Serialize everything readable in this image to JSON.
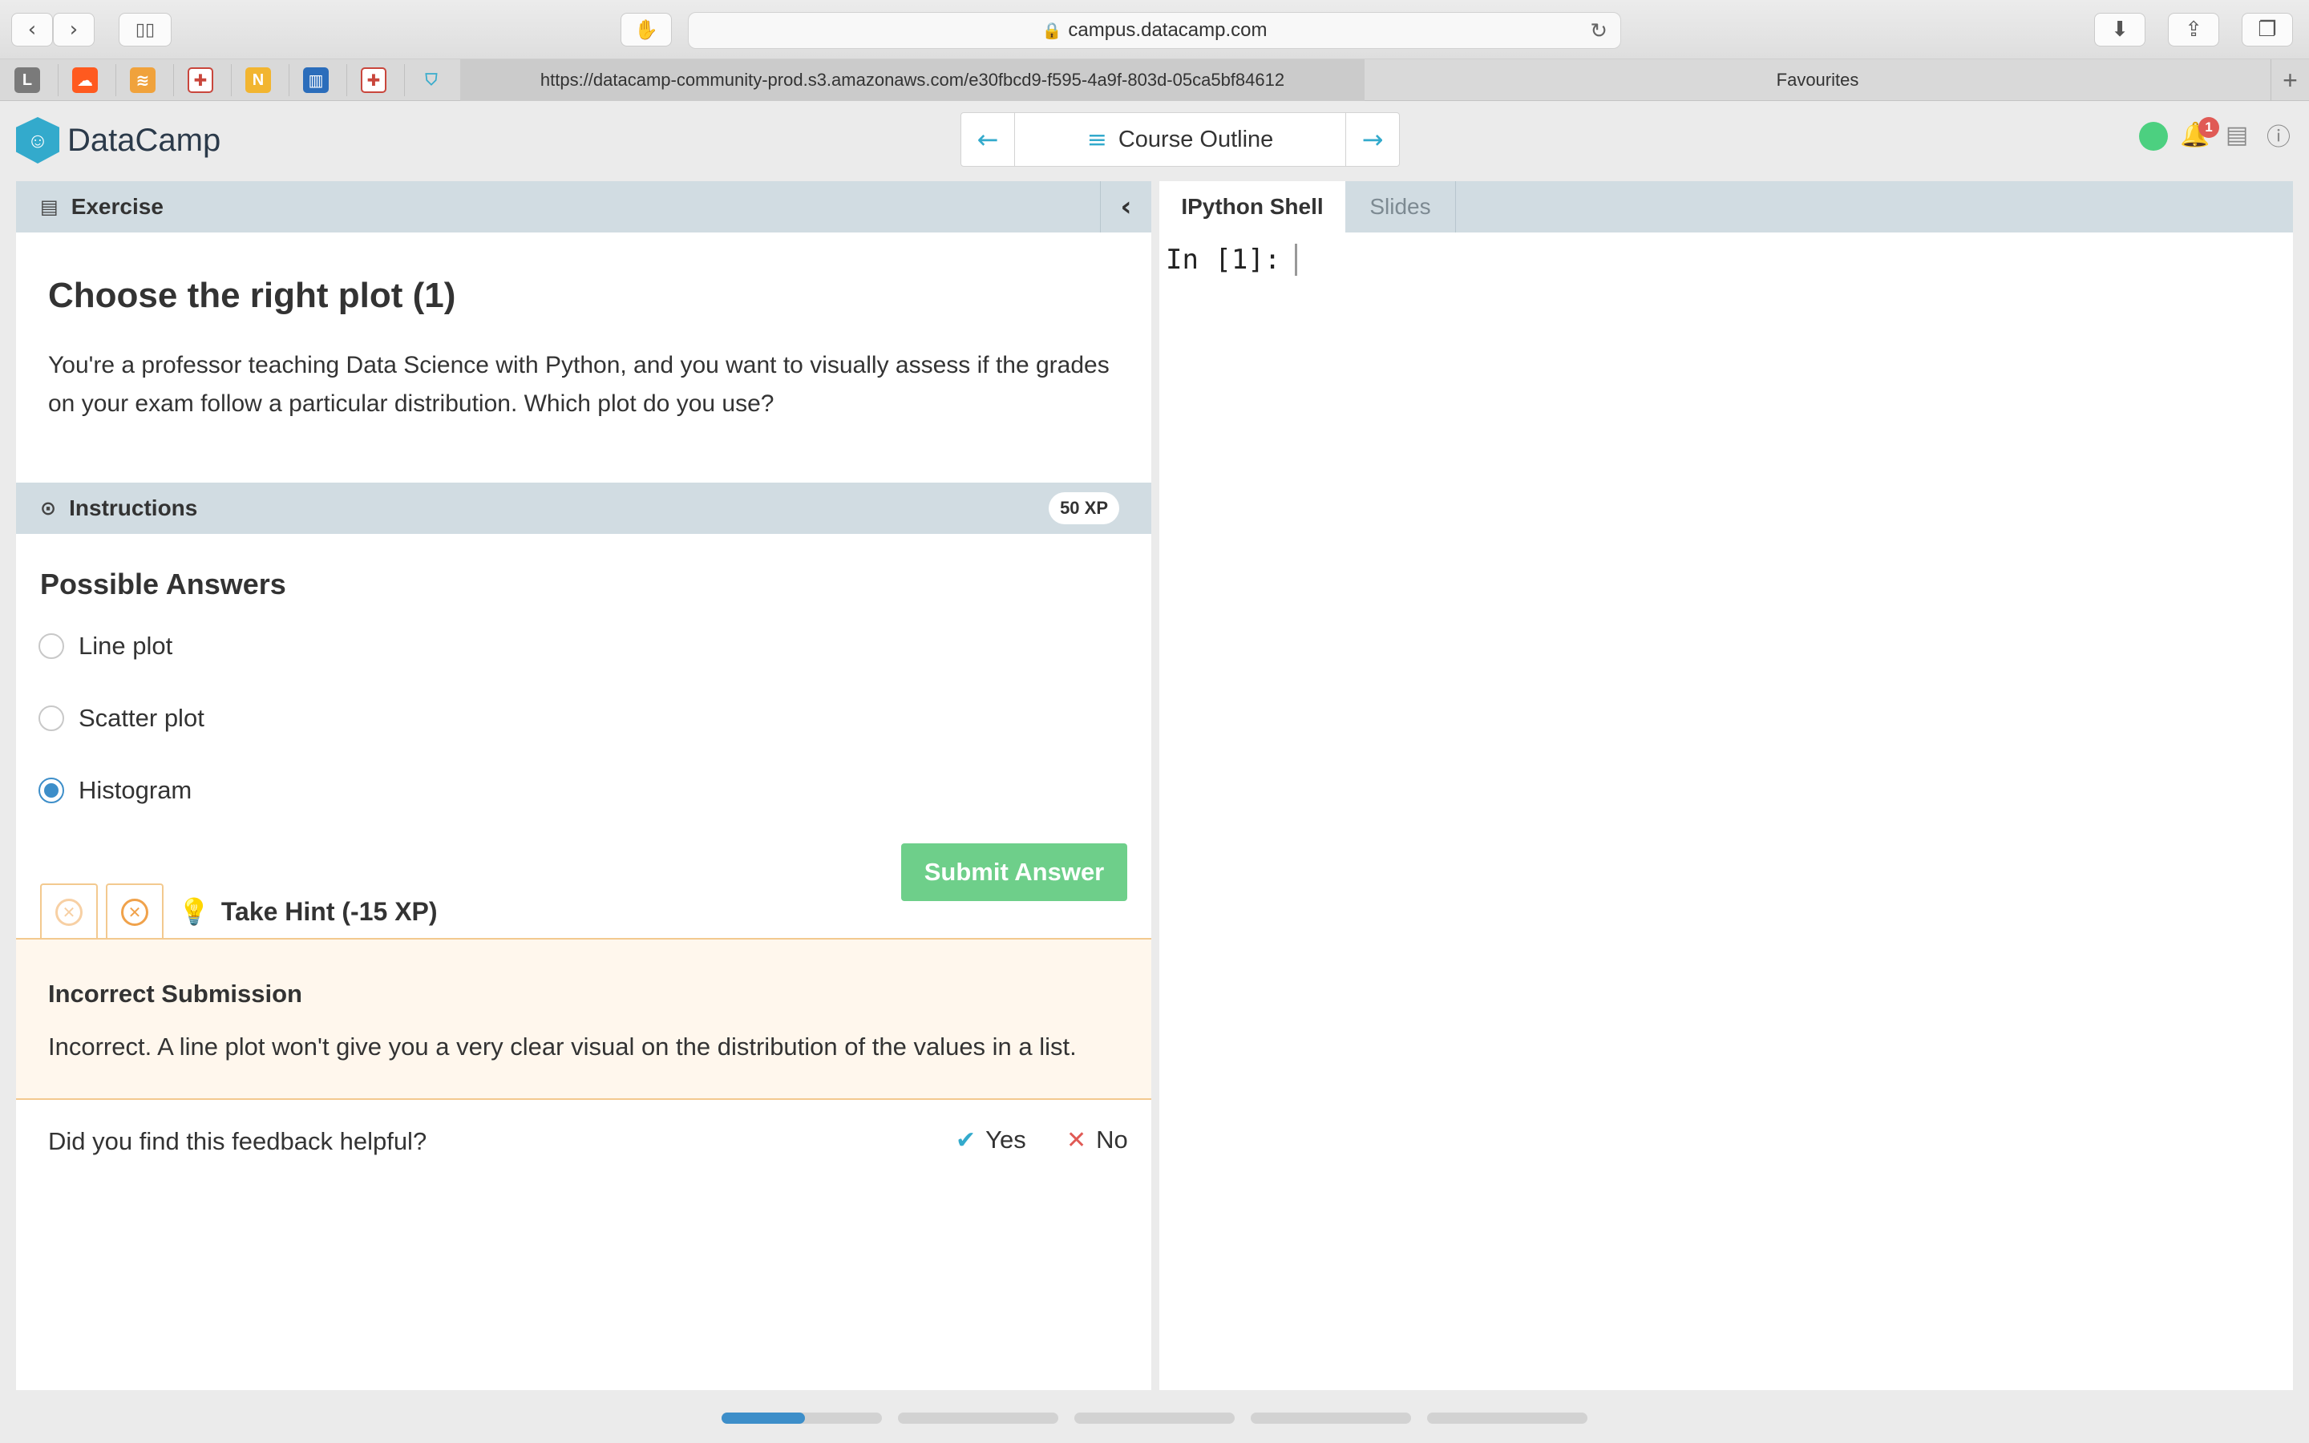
{
  "browser": {
    "url_display": "campus.datacamp.com",
    "tab_url": "https://datacamp-community-prod.s3.amazonaws.com/e30fbcd9-f595-4a9f-803d-05ca5bf84612",
    "tab_favourites": "Favourites",
    "favicons": [
      {
        "icon": "L",
        "color": "#7a7a7a"
      },
      {
        "icon": "soundcloud-icon",
        "color": "#ff5a1f"
      },
      {
        "icon": "stack-icon",
        "color": "#f0a23c"
      },
      {
        "icon": "cross-icon",
        "color": "#c9463c"
      },
      {
        "icon": "N",
        "color": "#f2b530"
      },
      {
        "icon": "trello-icon",
        "color": "#2b6dbb"
      },
      {
        "icon": "cross-icon",
        "color": "#c9463c"
      },
      {
        "icon": "shield-icon",
        "color": "#3aaccc"
      }
    ]
  },
  "header": {
    "brand": "DataCamp",
    "course_outline": "Course Outline",
    "notification_count": "1"
  },
  "exercise": {
    "tab_label": "Exercise",
    "title": "Choose the right plot (1)",
    "body": "You're a professor teaching Data Science with Python, and you want to visually assess if the grades on your exam follow a particular distribution. Which plot do you use?"
  },
  "instructions": {
    "label": "Instructions",
    "xp": "50 XP",
    "answers_title": "Possible Answers",
    "options": [
      {
        "label": "Line plot",
        "selected": false
      },
      {
        "label": "Scatter plot",
        "selected": false
      },
      {
        "label": "Histogram",
        "selected": true
      }
    ],
    "submit": "Submit Answer",
    "hint": "Take Hint (-15 XP)"
  },
  "feedback": {
    "title": "Incorrect Submission",
    "text": "Incorrect. A line plot won't give you a very clear visual on the distribution of the values in a list.",
    "question": "Did you find this feedback helpful?",
    "yes": "Yes",
    "no": "No"
  },
  "console": {
    "tabs": [
      "IPython Shell",
      "Slides"
    ],
    "prompt": "In [1]:"
  },
  "progress": {
    "segments": 5,
    "current_fill": 0.52
  },
  "colors": {
    "accent": "#3aaccc",
    "submit_green": "#6ecf8a",
    "status_green": "#4cd080",
    "feedback_bg": "#fff7ed"
  }
}
